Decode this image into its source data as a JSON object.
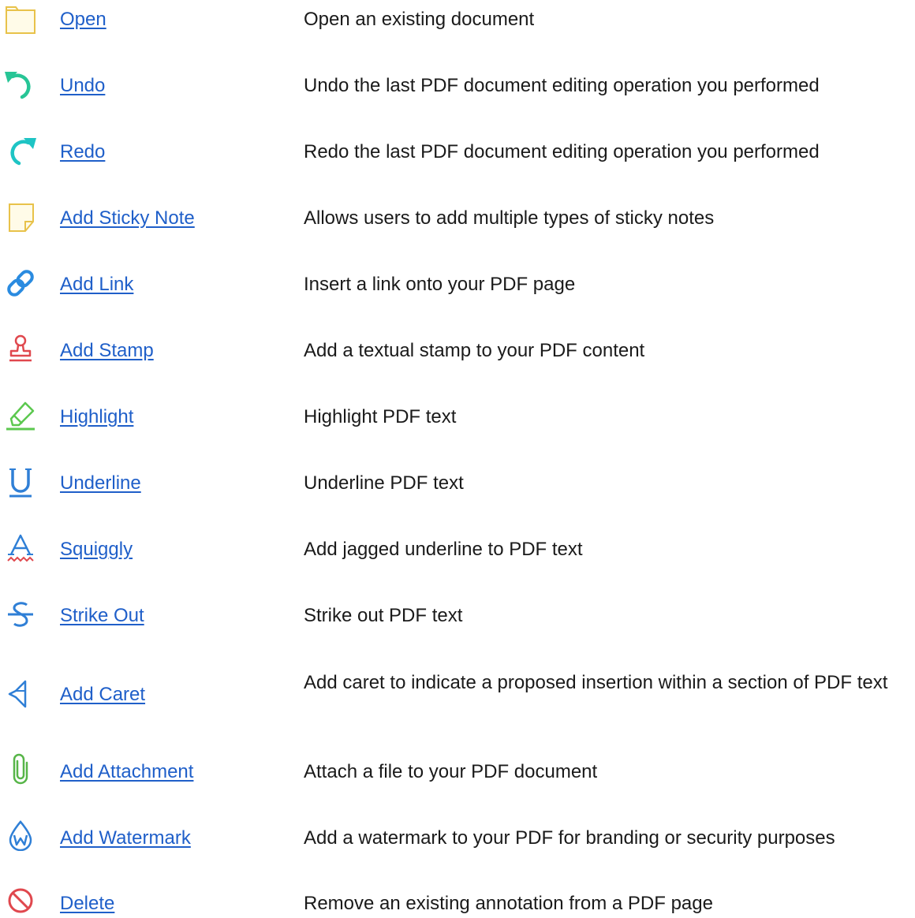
{
  "colors": {
    "link": "#1f5fc9",
    "text": "#1a1a1a",
    "folder": "#e8c24a",
    "undo": "#27c596",
    "redo": "#1ec4c4",
    "sticky": "#e8c24a",
    "link_icon": "#2a8be0",
    "stamp": "#e0484e",
    "highlight": "#5cc84f",
    "text_icon": "#2f7fd6",
    "squiggly_wave": "#e0484e",
    "attachment": "#57b548",
    "watermark": "#2f7fd6",
    "delete": "#e0484e"
  },
  "rows": [
    {
      "icon": "folder-icon",
      "label": "Open",
      "description": "Open an existing document"
    },
    {
      "icon": "undo-icon",
      "label": "Undo",
      "description": "Undo the last PDF document editing operation you performed"
    },
    {
      "icon": "redo-icon",
      "label": "Redo",
      "description": "Redo the last PDF document editing operation you performed"
    },
    {
      "icon": "sticky-note-icon",
      "label": "Add Sticky Note",
      "description": "Allows users to add multiple types of sticky notes"
    },
    {
      "icon": "link-icon",
      "label": "Add Link",
      "description": "Insert a link onto your PDF page"
    },
    {
      "icon": "stamp-icon",
      "label": "Add Stamp",
      "description": "Add a textual stamp to your PDF content"
    },
    {
      "icon": "highlighter-icon",
      "label": "Highlight",
      "description": "Highlight PDF text"
    },
    {
      "icon": "underline-icon",
      "label": "Underline",
      "description": "Underline PDF text"
    },
    {
      "icon": "squiggly-icon",
      "label": "Squiggly",
      "description": "Add jagged underline to PDF text"
    },
    {
      "icon": "strikeout-icon",
      "label": "Strike Out",
      "description": "Strike out PDF text"
    },
    {
      "icon": "caret-icon",
      "label": "Add Caret",
      "description": "Add caret to indicate a proposed insertion within a section of PDF text"
    },
    {
      "icon": "paperclip-icon",
      "label": "Add Attachment",
      "description": "Attach a file to your PDF document"
    },
    {
      "icon": "watermark-icon",
      "label": "Add Watermark",
      "description": "Add a watermark to your PDF for branding or security purposes"
    },
    {
      "icon": "delete-icon",
      "label": "Delete",
      "description": "Remove an existing annotation from a PDF page"
    }
  ]
}
